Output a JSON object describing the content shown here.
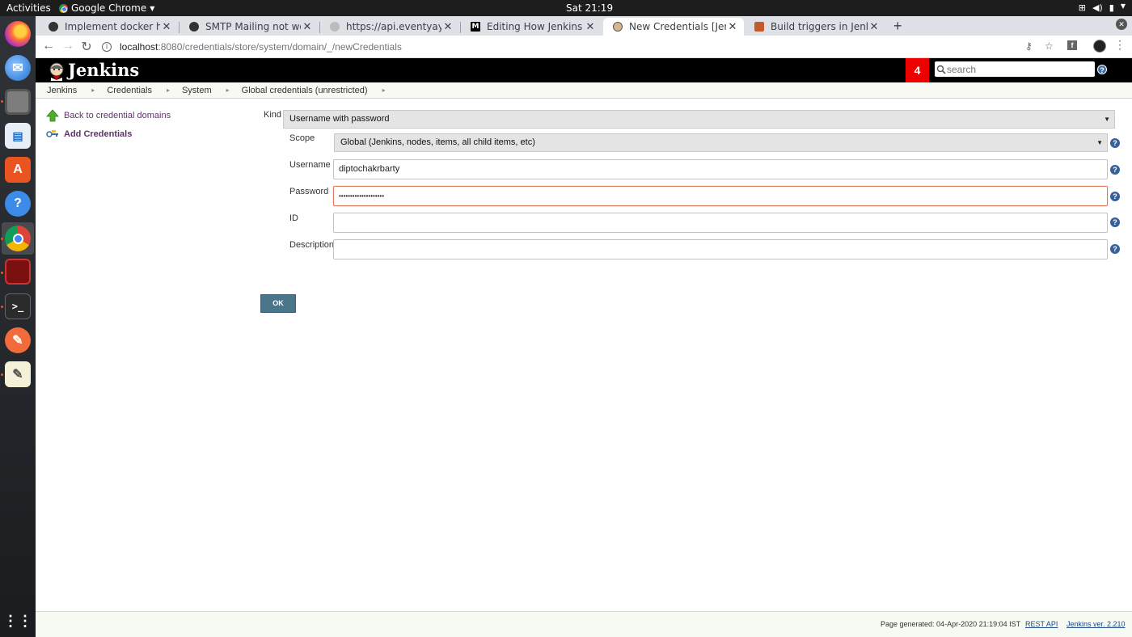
{
  "os_bar": {
    "activities": "Activities",
    "app_name": "Google Chrome",
    "clock": "Sat 21:19"
  },
  "browser": {
    "tabs": [
      {
        "label": "Implement docker health",
        "active": false
      },
      {
        "label": "SMTP Mailing not working",
        "active": false
      },
      {
        "label": "https://api.eventyay.com/",
        "active": false
      },
      {
        "label": "Editing How Jenkins can",
        "active": false
      },
      {
        "label": "New Credentials [Jenkins",
        "active": true
      },
      {
        "label": "Build triggers in Jenkins",
        "active": false
      }
    ],
    "new_tab": "+",
    "url_host": "localhost",
    "url_path": ":8080/credentials/store/system/domain/_/newCredentials"
  },
  "jenkins": {
    "title": "Jenkins",
    "notification_count": "4",
    "search_placeholder": "search",
    "breadcrumbs": [
      "Jenkins",
      "Credentials",
      "System",
      "Global credentials (unrestricted)"
    ],
    "side_tasks": [
      {
        "label": "Back to credential domains",
        "icon": "up-arrow-icon"
      },
      {
        "label": "Add Credentials",
        "icon": "key-icon"
      }
    ],
    "form": {
      "kind_label": "Kind",
      "kind_value": "Username with password",
      "scope_label": "Scope",
      "scope_value": "Global (Jenkins, nodes, items, all child items, etc)",
      "username_label": "Username",
      "username_value": "diptochakrbarty",
      "password_label": "Password",
      "password_value": "••••••••••••••••••••",
      "id_label": "ID",
      "id_value": "",
      "description_label": "Description",
      "description_value": "",
      "ok_label": "OK"
    },
    "footer": {
      "generated": "Page generated: 04-Apr-2020 21:19:04 IST",
      "rest_api": "REST API",
      "version": "Jenkins ver. 2.210"
    }
  }
}
